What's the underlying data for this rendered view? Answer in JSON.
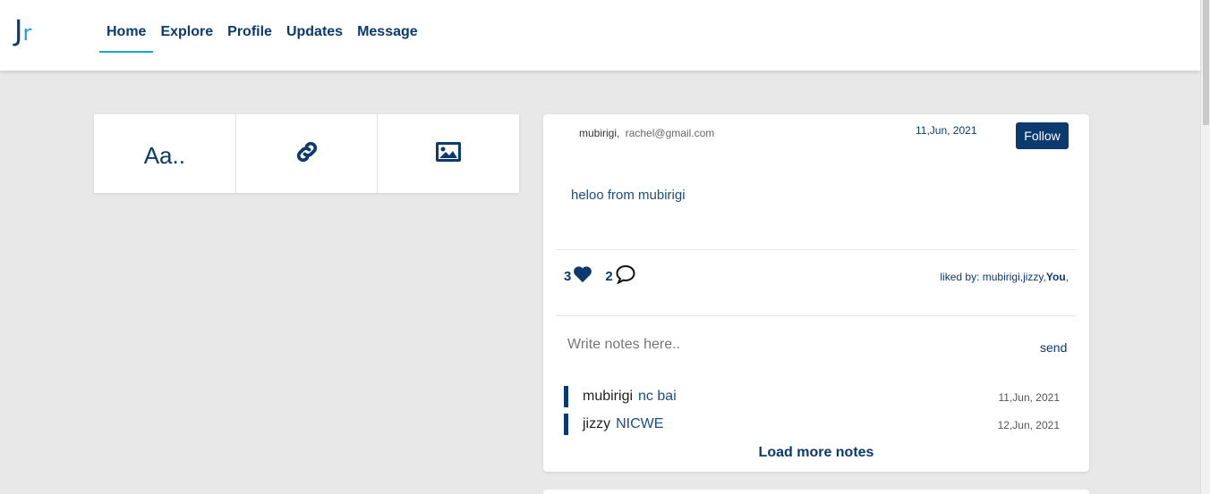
{
  "logo": {
    "letter1": "J",
    "letter2": "r"
  },
  "nav": {
    "items": [
      {
        "label": "Home",
        "active": true
      },
      {
        "label": "Explore"
      },
      {
        "label": "Profile"
      },
      {
        "label": "Updates"
      },
      {
        "label": "Message"
      }
    ]
  },
  "composer": {
    "text_option": "Aa..",
    "link_icon": "link-icon",
    "image_icon": "image-icon"
  },
  "post": {
    "author": "mubirigi,",
    "email": "rachel@gmail.com",
    "date": "11,Jun, 2021",
    "follow_label": "Follow",
    "text": "heloo from mubirigi",
    "likes": "3",
    "comments": "2",
    "liked_by_prefix": "liked by: mubirigi,jizzy,",
    "liked_by_you": "You",
    "liked_by_suffix": ",",
    "notes_placeholder": "Write notes here..",
    "send_label": "send",
    "notes": [
      {
        "user": "mubirigi",
        "text": "nc bai",
        "date": "11,Jun, 2021"
      },
      {
        "user": "jizzy",
        "text": "NICWE",
        "date": "12,Jun, 2021"
      }
    ],
    "load_more_label": "Load more notes"
  },
  "colors": {
    "primary": "#0b3a6e",
    "accent": "#1e9fd8",
    "background": "#e8e8e8"
  }
}
